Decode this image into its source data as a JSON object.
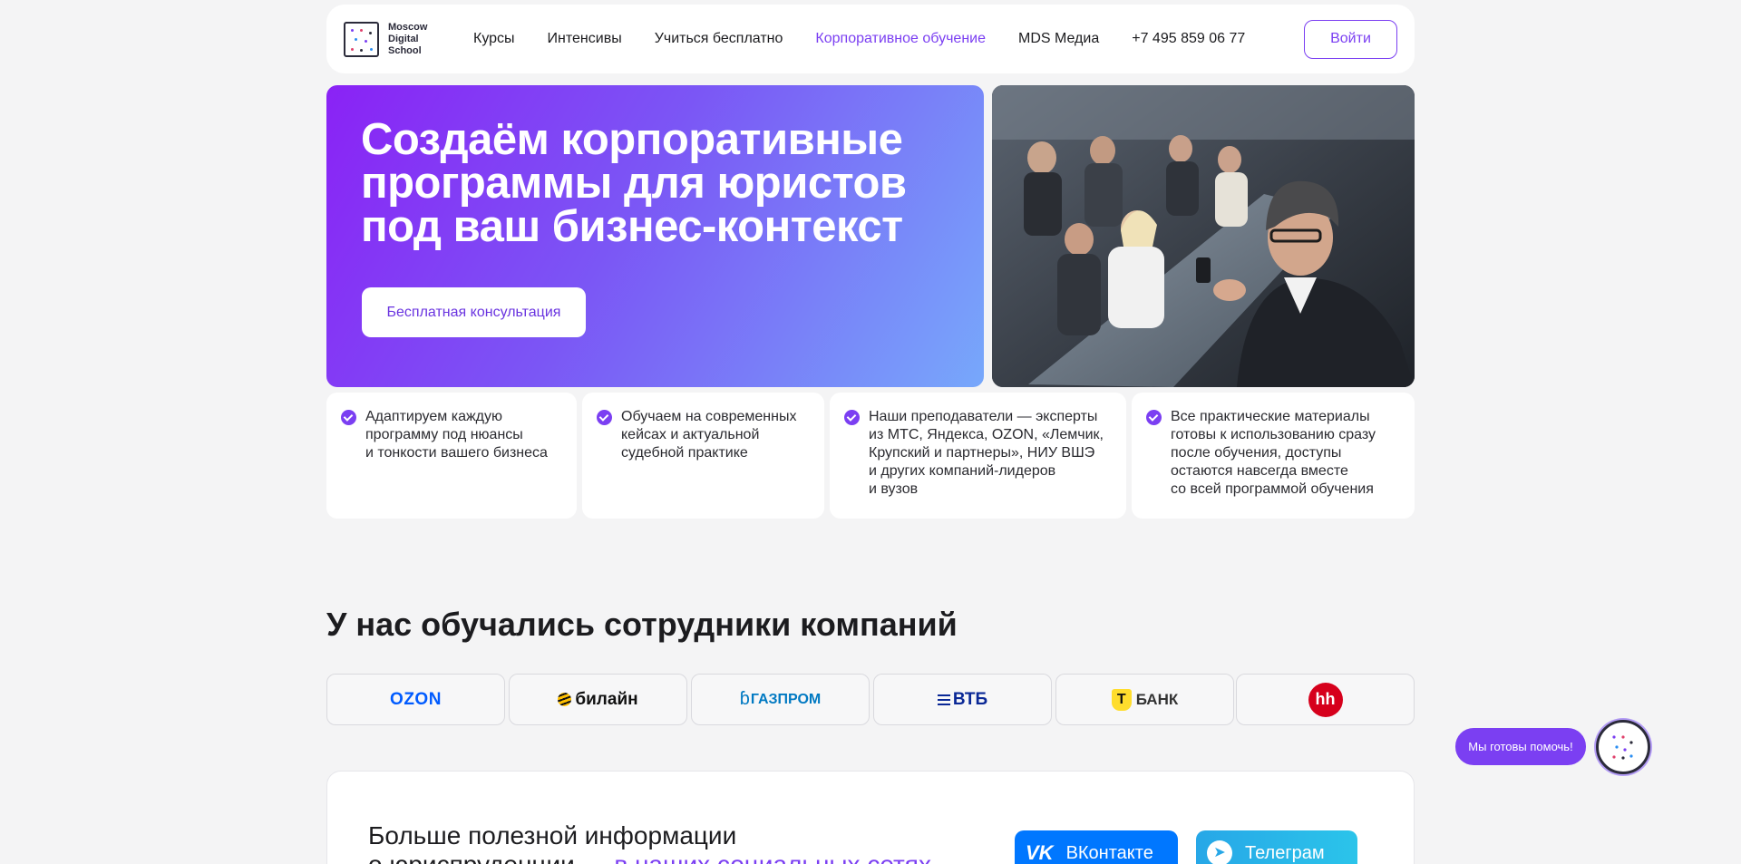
{
  "header": {
    "logo_text": [
      "Moscow",
      "Digital",
      "School"
    ],
    "nav": [
      {
        "label": "Курсы",
        "active": false
      },
      {
        "label": "Интенсивы",
        "active": false
      },
      {
        "label": "Учиться бесплатно",
        "active": false
      },
      {
        "label": "Корпоративное обучение",
        "active": true
      },
      {
        "label": "MDS Медиа",
        "active": false
      }
    ],
    "phone": "+7 495 859 06 77",
    "login_label": "Войти"
  },
  "hero": {
    "title": "Создаём корпоративные программы для юристов под ваш бизнес-контекст",
    "cta_label": "Бесплатная консультация"
  },
  "features": [
    "Адаптируем каждую\nпрограмму под нюансы\nи тонкости вашего бизнеса",
    "Обучаем на современных\nкейсах и актуальной\nсудебной практике",
    "Наши преподаватели — эксперты\nиз МТС, Яндекса, OZON, «Лемчик,\nКрупский и партнеры», НИУ ВШЭ\nи других компаний-лидеров\nи вузов",
    "Все практические материалы\nготовы к использованию сразу\nпосле обучения, доступы\nостаются навсегда вместе\nсо всей программой обучения"
  ],
  "companies": {
    "title": "У нас обучались сотрудники компаний",
    "logos": [
      "OZON",
      "билайн",
      "ГАЗПРОМ",
      "ВТБ",
      "БАНК",
      "hh"
    ]
  },
  "info": {
    "title_line1": "Больше полезной информации",
    "title_line2_plain": "о юриспруденции — ",
    "title_line2_accent": "в наших социальных сетях",
    "vk_label": "ВКонтакте",
    "tg_label": "Телеграм"
  },
  "helper": {
    "label": "Мы готовы помочь!"
  },
  "colors": {
    "accent": "#7b3ff2",
    "ozon": "#005bff",
    "gazprom": "#0079c2",
    "vtb": "#0a2896",
    "tbank_yellow": "#ffdd2d",
    "hh_red": "#d6001c",
    "vk": "#0077ff",
    "telegram": "#27a7e7"
  }
}
